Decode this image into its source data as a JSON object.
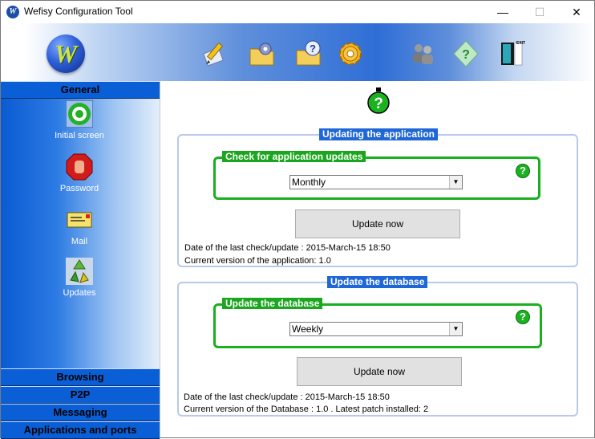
{
  "window": {
    "title": "Wefisy Configuration Tool",
    "minimize": "—",
    "maximize": "☐",
    "close": "✕"
  },
  "toolbar": {
    "logo_letter": "W",
    "icons": [
      "edit-icon",
      "settings-folder-icon",
      "help-folder-icon",
      "gear-icon",
      "users-icon",
      "help-icon",
      "exit-icon"
    ],
    "exit_label": "EXIT"
  },
  "sidebar": {
    "sections": {
      "general": "General",
      "browsing": "Browsing",
      "p2p": "P2P",
      "messaging": "Messaging",
      "apps": "Applications and ports"
    },
    "items": [
      {
        "label": "Initial screen",
        "icon": "target-icon"
      },
      {
        "label": "Password",
        "icon": "stop-hand-icon"
      },
      {
        "label": "Mail",
        "icon": "envelope-icon"
      },
      {
        "label": "Updates",
        "icon": "recycle-icon"
      }
    ]
  },
  "main": {
    "app_group": {
      "title": "Updating the application",
      "sub_title": "Check for application updates",
      "frequency": "Monthly",
      "button": "Update now",
      "last_check": "Date of the last check/update : 2015-March-15 18:50",
      "version": "Current version of the application: 1.0"
    },
    "db_group": {
      "title": "Update the database",
      "sub_title": "Update the database",
      "frequency": "Weekly",
      "button": "Update now",
      "last_check": "Date of the last check/update : 2015-March-15 18:50",
      "version": "Current version of the Database : 1.0 . Latest patch installed: 2"
    }
  },
  "colors": {
    "section_blue": "#0b5fd6",
    "group_title_blue": "#1f66d6",
    "green": "#18b01c"
  }
}
